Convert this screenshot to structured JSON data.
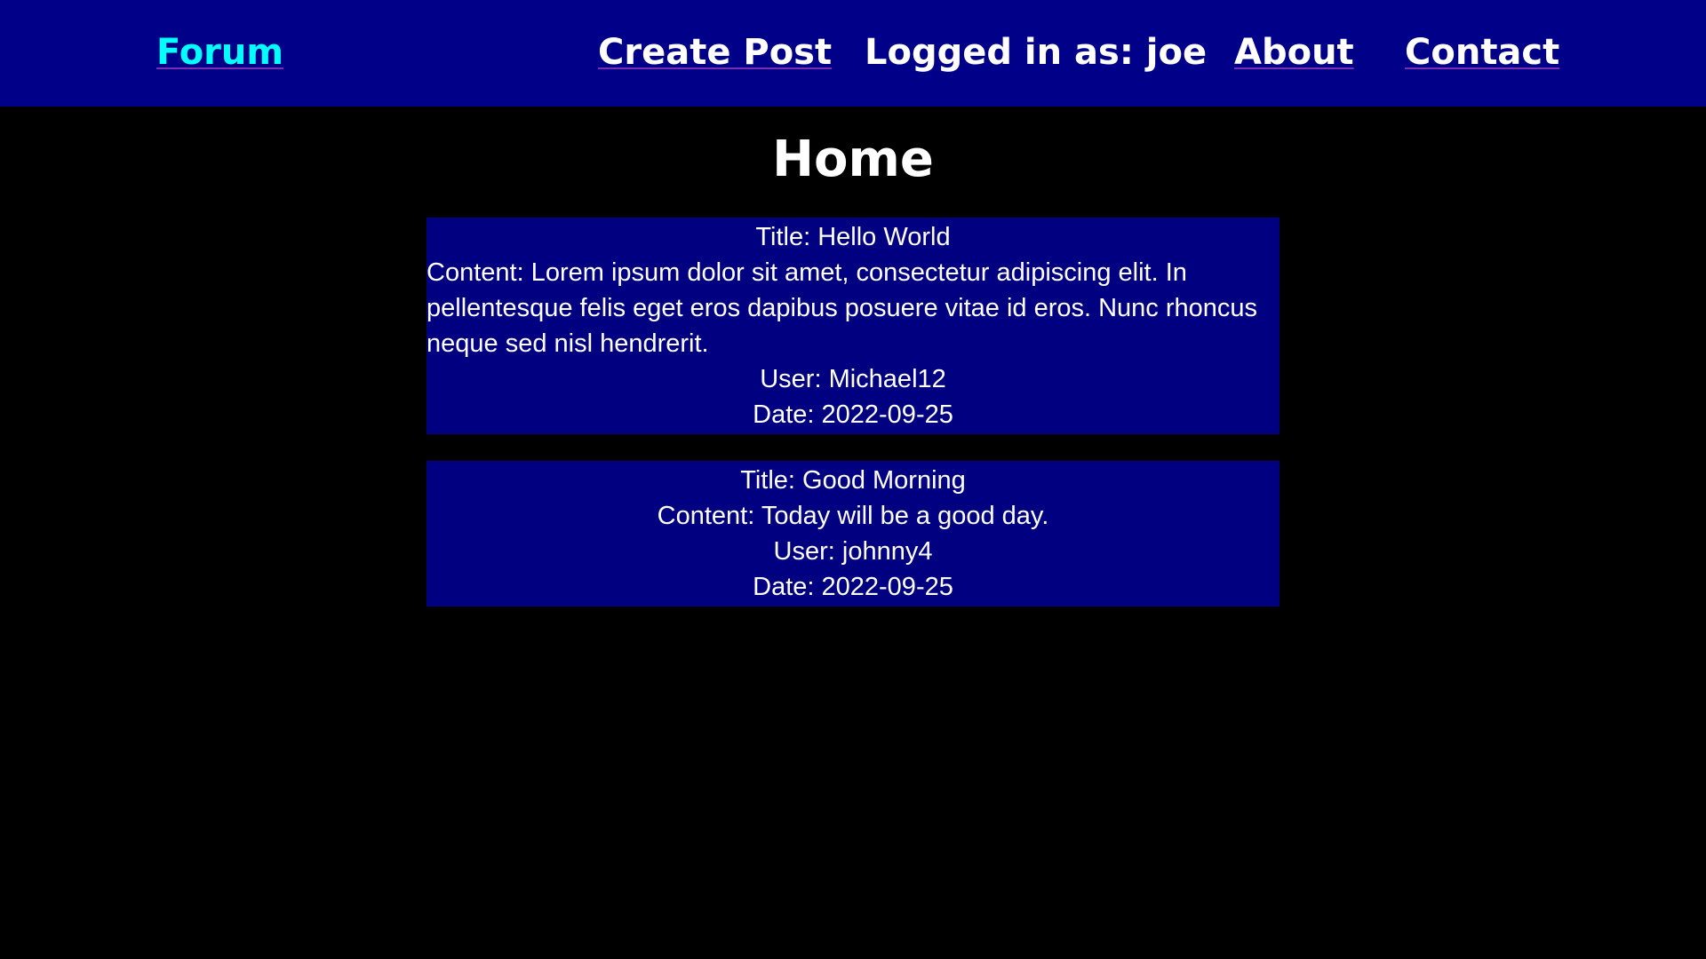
{
  "nav": {
    "brand": "Forum",
    "create_post": "Create Post",
    "logged_in": "Logged in as: joe",
    "about": "About",
    "contact": "Contact"
  },
  "page": {
    "title": "Home"
  },
  "posts": [
    {
      "title": "Title: Hello World",
      "content": "Content: Lorem ipsum dolor sit amet, consectetur adipiscing elit. In pellentesque felis eget eros dapibus posuere vitae id eros. Nunc rhoncus neque sed nisl hendrerit.",
      "user": "User: Michael12",
      "date": "Date: 2022-09-25"
    },
    {
      "title": "Title: Good Morning",
      "content": "Content: Today will be a good day.",
      "user": "User: johnny4",
      "date": "Date: 2022-09-25"
    }
  ],
  "colors": {
    "navbar_bg": "#000088",
    "brand": "#00ffff",
    "post_bg": "#000080",
    "page_bg": "#000000"
  }
}
